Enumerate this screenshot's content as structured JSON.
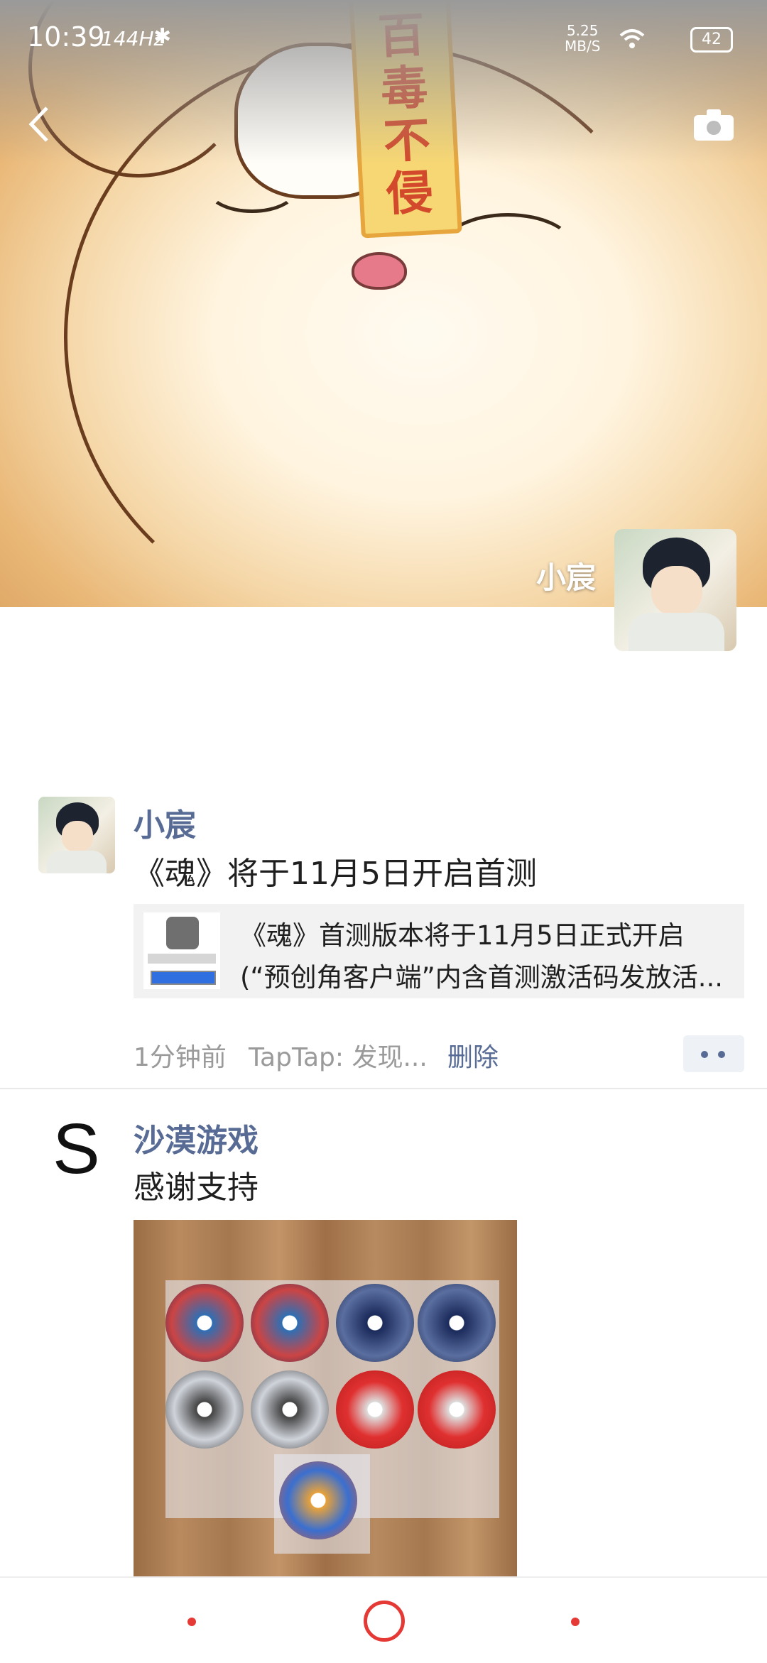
{
  "status_bar": {
    "time": "10:39",
    "refresh_rate": "144Hz",
    "net_speed_value": "5.25",
    "net_speed_unit": "MB/S",
    "battery": "42"
  },
  "cover": {
    "banner_text": [
      "百",
      "毒",
      "不",
      "侵"
    ],
    "user_name": "小宸"
  },
  "posts": [
    {
      "author": "小宸",
      "text": "《魂》将于11月5日开启首测",
      "link": {
        "line1": "《魂》首测版本将于11月5日正式开启",
        "line2": "(“预创角客户端”内含首测激活码发放活..."
      },
      "time": "1分钟前",
      "source": "TapTap: 发现...",
      "delete_label": "删除"
    },
    {
      "author": "沙漠游戏",
      "avatar_letter": "S",
      "text": "感谢支持"
    }
  ],
  "colors": {
    "link_blue": "#576b95",
    "accent_red": "#e53935"
  }
}
